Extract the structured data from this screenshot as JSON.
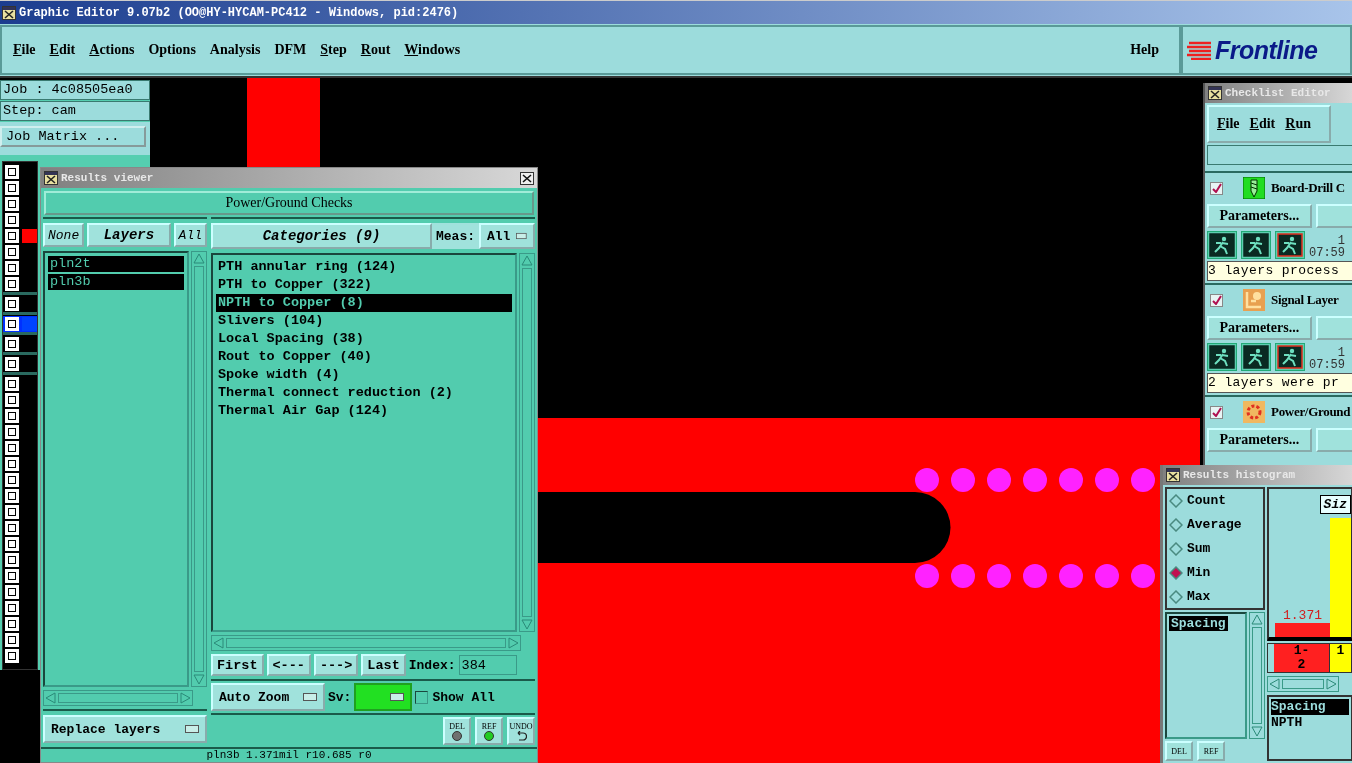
{
  "app_window": {
    "title": "Graphic Editor 9.07b2 (OO@HY-HYCAM-PC412 - Windows, pid:2476)"
  },
  "menu": [
    {
      "label": "File",
      "mnemonic": true
    },
    {
      "label": "Edit",
      "mnemonic": true
    },
    {
      "label": "Actions",
      "mnemonic": true
    },
    {
      "label": "Options",
      "mnemonic": false
    },
    {
      "label": "Analysis",
      "mnemonic": false
    },
    {
      "label": "DFM",
      "mnemonic": false
    },
    {
      "label": "Step",
      "mnemonic": true
    },
    {
      "label": "Rout",
      "mnemonic": true
    },
    {
      "label": "Windows",
      "mnemonic": true
    }
  ],
  "help": "Help",
  "logo": "Frontline",
  "job_panel": {
    "job": "Job : 4c08505ea0",
    "step": "Step: cam",
    "matrix_button": "Job Matrix ..."
  },
  "layer_groups": [
    {
      "rows": [
        {
          "selected": false
        },
        {
          "selected": false
        },
        {
          "selected": false
        },
        {
          "selected": false
        },
        {
          "selected": false,
          "color": "#ff0000"
        },
        {
          "selected": false
        },
        {
          "selected": false
        },
        {
          "selected": false
        }
      ]
    },
    {
      "rows": [
        {
          "selected": false
        }
      ]
    },
    {
      "rows": [
        {
          "selected": true,
          "color": "#0044ff"
        }
      ]
    },
    {
      "rows": [
        {
          "selected": false
        }
      ]
    },
    {
      "rows": [
        {
          "selected": false
        }
      ]
    },
    {
      "rows": [
        {
          "selected": false
        },
        {
          "selected": false
        },
        {
          "selected": false
        },
        {
          "selected": false
        },
        {
          "selected": false
        },
        {
          "selected": false
        },
        {
          "selected": false
        },
        {
          "selected": false
        },
        {
          "selected": false
        },
        {
          "selected": false
        },
        {
          "selected": false
        },
        {
          "selected": false
        },
        {
          "selected": false
        },
        {
          "selected": false
        },
        {
          "selected": false
        },
        {
          "selected": false
        },
        {
          "selected": false
        },
        {
          "selected": false
        }
      ]
    }
  ],
  "results_viewer": {
    "title": "Results viewer",
    "header": "Power/Ground Checks",
    "layer_buttons": [
      "None",
      "Layers",
      "All"
    ],
    "layers": [
      {
        "label": "pln2t",
        "selected": true
      },
      {
        "label": "pln3b",
        "selected": true
      }
    ],
    "replace_dropdown": "Replace layers",
    "categories_button": "Categories (9)",
    "meas_label": "Meas:",
    "meas_value": "All",
    "categories": [
      {
        "label": "PTH annular ring (124)",
        "selected": false
      },
      {
        "label": "PTH to Copper (322)",
        "selected": false
      },
      {
        "label": "NPTH to Copper (8)",
        "selected": true
      },
      {
        "label": "Slivers (104)",
        "selected": false
      },
      {
        "label": "Local Spacing (38)",
        "selected": false
      },
      {
        "label": "Rout to Copper (40)",
        "selected": false
      },
      {
        "label": "Spoke width (4)",
        "selected": false
      },
      {
        "label": "Thermal connect reduction (2)",
        "selected": false
      },
      {
        "label": "Thermal Air Gap (124)",
        "selected": false
      }
    ],
    "nav_buttons": [
      "First",
      "<---",
      "--->",
      "Last"
    ],
    "index_label": "Index:",
    "index_value": "384",
    "zoom_dropdown": "Auto Zoom",
    "sv_label": "Sv:",
    "show_all": {
      "label": "Show All",
      "checked": false
    },
    "action_buttons": [
      {
        "label": "DEL",
        "kind": "dot",
        "color": "#707070"
      },
      {
        "label": "REF",
        "kind": "dot",
        "color": "#22cc22"
      },
      {
        "label": "UNDO",
        "kind": "undo"
      }
    ],
    "status": "pln3b 1.371mil r10.685 r0"
  },
  "checklist_editor": {
    "title": "Checklist Editor",
    "menu": [
      "File",
      "Edit",
      "Run"
    ],
    "checks": [
      {
        "kind": "drill",
        "checked": true,
        "name": "Board-Drill C",
        "button": "Parameters...",
        "time_1": "1",
        "time_2": "07:59",
        "status": "3 layers process"
      },
      {
        "kind": "signal",
        "checked": true,
        "name": "Signal Layer",
        "button": "Parameters...",
        "time_1": "1",
        "time_2": "07:59",
        "status": "2 layers were pr"
      },
      {
        "kind": "power",
        "checked": true,
        "name": "Power/Ground",
        "button": "Parameters..."
      }
    ]
  },
  "results_histogram": {
    "title": "Results histogram",
    "modes": [
      {
        "label": "Count",
        "selected": false
      },
      {
        "label": "Average",
        "selected": false
      },
      {
        "label": "Sum",
        "selected": false
      },
      {
        "label": "Min",
        "selected": true
      },
      {
        "label": "Max",
        "selected": false
      }
    ],
    "metrics": [
      {
        "label": "Spacing",
        "selected": true
      }
    ],
    "size_button": "Siz",
    "bar_label": "1.371",
    "bins": [
      {
        "label": "1-\n2",
        "color": "#ff2020"
      },
      {
        "label": "1",
        "color": "#ffff00"
      }
    ],
    "details": [
      {
        "label": "Spacing",
        "selected": true
      },
      {
        "label": "NPTH",
        "selected": false
      }
    ],
    "buttons": [
      "DEL",
      "REF"
    ]
  }
}
